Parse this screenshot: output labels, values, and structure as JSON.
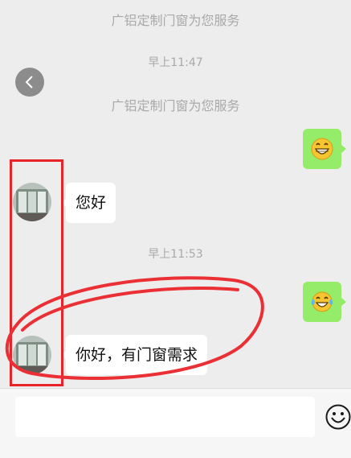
{
  "messages": {
    "notice_1": "广铝定制门窗为您服务",
    "time_1": "早上11:47",
    "notice_2": "广铝定制门窗为您服务",
    "greeting": "您好",
    "time_2": "早上11:53",
    "request": "你好，有门窗需求"
  },
  "emojis": {
    "grin": "grinning-face-emoji",
    "laugh": "tears-of-joy-emoji"
  },
  "input": {
    "placeholder": ""
  },
  "colors": {
    "background": "#ededed",
    "sent_bubble": "#95ec69",
    "received_bubble": "#ffffff",
    "annotation": "#e8232a"
  }
}
